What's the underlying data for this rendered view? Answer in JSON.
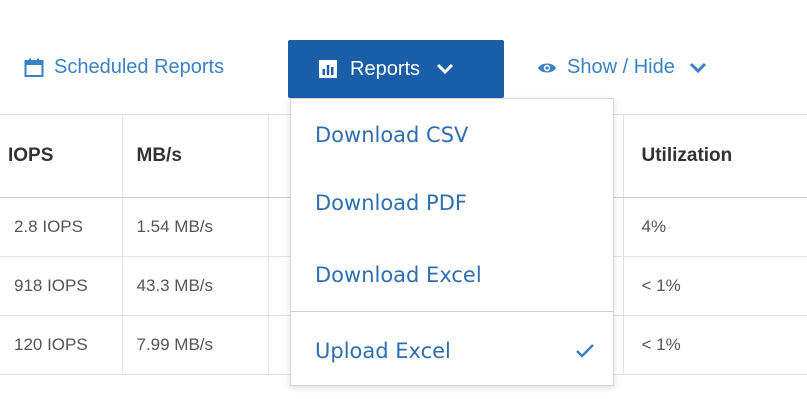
{
  "toolbar": {
    "scheduled_reports_label": "Scheduled Reports",
    "reports_label": "Reports",
    "show_hide_label": "Show / Hide"
  },
  "table": {
    "headers": [
      "IOPS",
      "MB/s",
      "",
      "Utilization"
    ],
    "rows": [
      [
        "2.8 IOPS",
        "1.54 MB/s",
        "",
        "4%"
      ],
      [
        "918 IOPS",
        "43.3 MB/s",
        "",
        "< 1%"
      ],
      [
        "120 IOPS",
        "7.99 MB/s",
        "",
        "< 1%"
      ]
    ]
  },
  "reports_menu": {
    "items": [
      {
        "label": "Download CSV",
        "checked": false
      },
      {
        "label": "Download PDF",
        "checked": false
      },
      {
        "label": "Download Excel",
        "checked": false
      },
      {
        "label": "Upload Excel",
        "checked": true
      }
    ]
  },
  "colors": {
    "accent": "#3a82c5",
    "button_bg": "#1a5ea8",
    "menu_text": "#2f6fb0"
  },
  "icons": {
    "scheduled_reports": "calendar-icon",
    "reports": "bar-chart-icon",
    "show_hide": "eye-icon",
    "chevron": "chevron-down-icon",
    "check": "checkmark-icon"
  }
}
